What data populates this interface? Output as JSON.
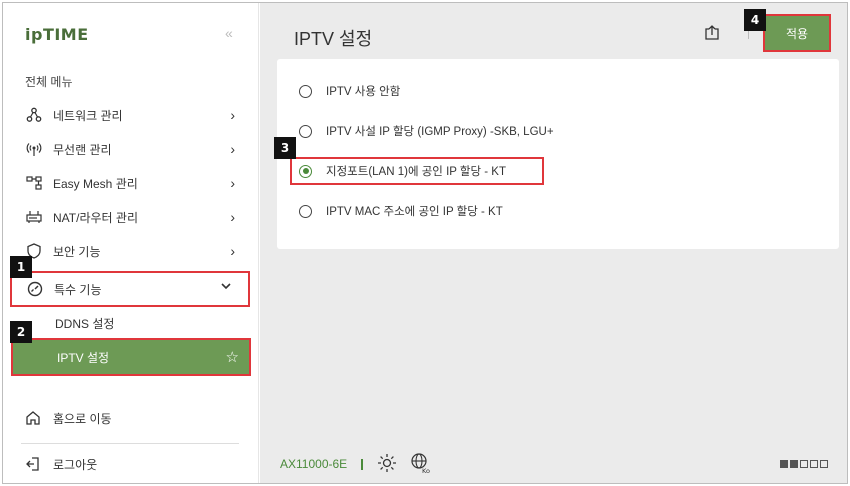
{
  "sidebar": {
    "logo": "ipTIME",
    "collapse_label": "«",
    "menu_title": "전체 메뉴",
    "items": [
      {
        "label": "네트워크 관리",
        "icon": "network-icon"
      },
      {
        "label": "무선랜 관리",
        "icon": "wireless-icon"
      },
      {
        "label": "Easy Mesh 관리",
        "icon": "mesh-icon"
      },
      {
        "label": "NAT/라우터 관리",
        "icon": "router-icon"
      },
      {
        "label": "보안 기능",
        "icon": "security-icon"
      },
      {
        "label": "특수 기능",
        "icon": "special-icon",
        "expanded": true
      }
    ],
    "sub_items": [
      {
        "label": "DDNS 설정",
        "active": false
      },
      {
        "label": "IPTV 설정",
        "active": true
      }
    ],
    "home_label": "홈으로 이동",
    "logout_label": "로그아웃"
  },
  "main": {
    "title": "IPTV 설정",
    "apply_label": "적용",
    "options": [
      {
        "label": "IPTV 사용 안함",
        "checked": false
      },
      {
        "label": "IPTV 사설 IP 할당 (IGMP Proxy) -SKB, LGU+",
        "checked": false
      },
      {
        "label": "지정포트(LAN 1)에 공인 IP 할당 - KT",
        "checked": true
      },
      {
        "label": "IPTV MAC 주소에 공인 IP 할당 - KT",
        "checked": false
      }
    ]
  },
  "footer": {
    "model": "AX11000-6E",
    "lang_code": "Ko"
  },
  "badges": [
    "1",
    "2",
    "3",
    "4"
  ],
  "colors": {
    "accent": "#6d9a55",
    "highlight": "#e0363b",
    "badge": "#111111"
  }
}
